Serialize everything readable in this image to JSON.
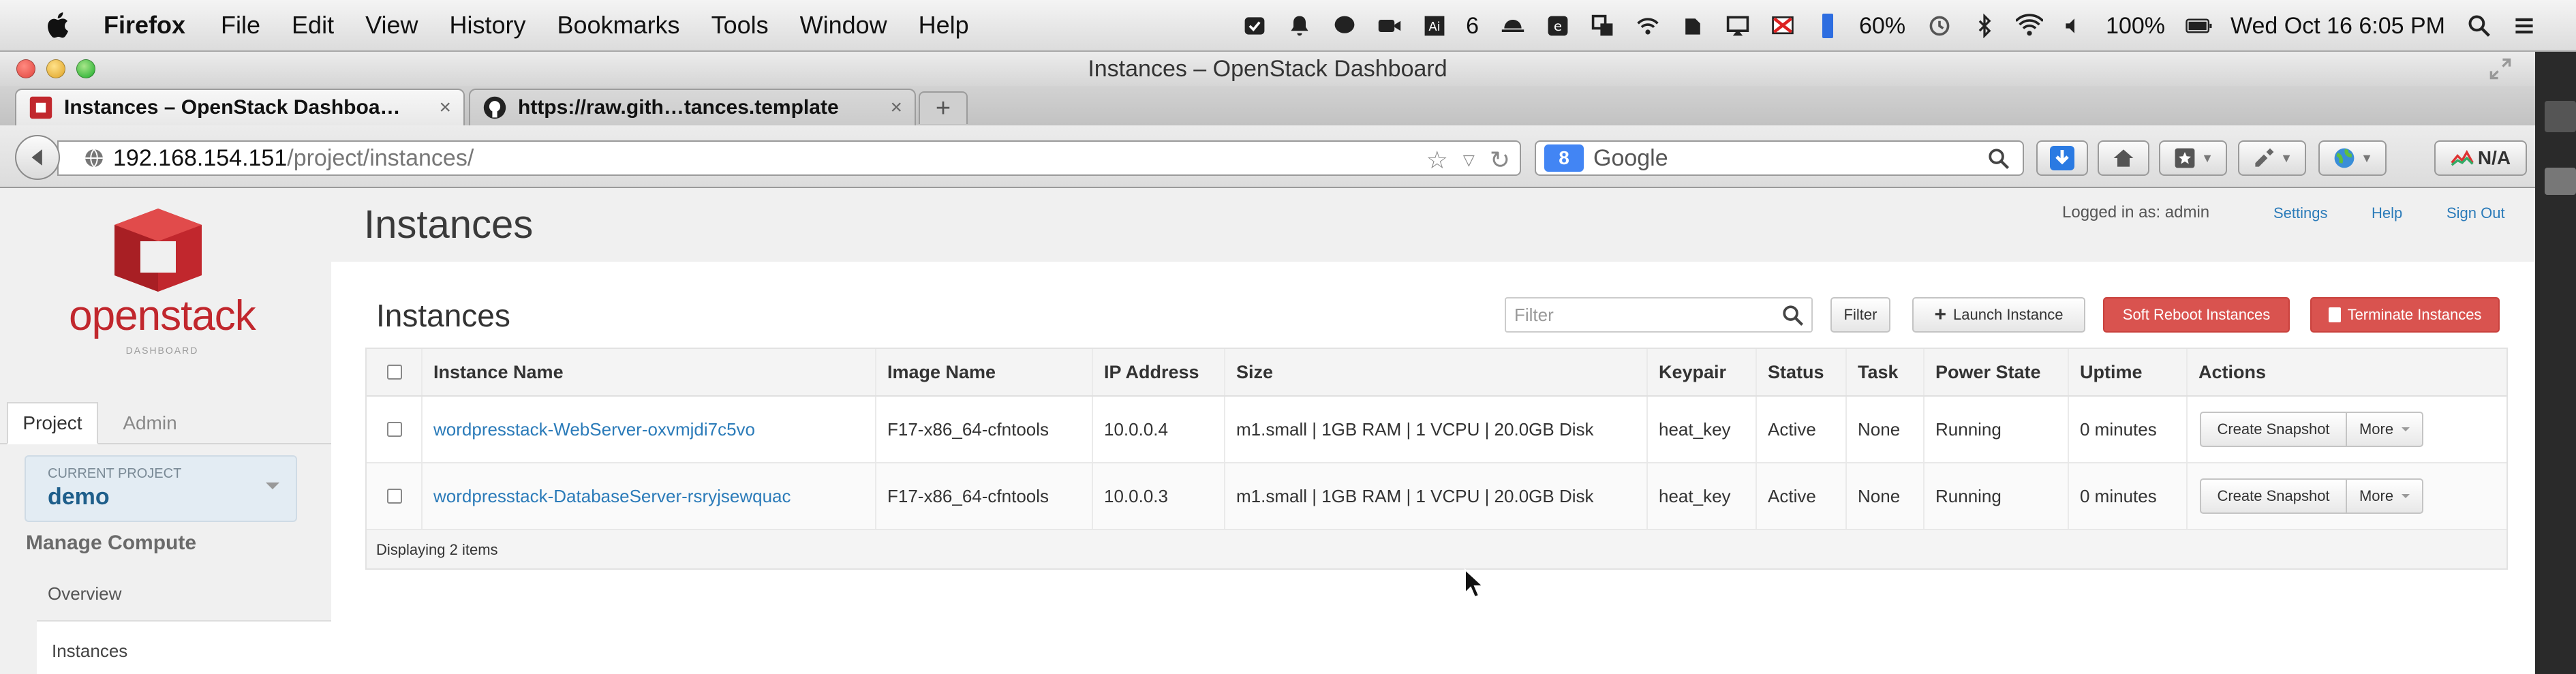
{
  "menubar": {
    "app_name": "Firefox",
    "items": [
      "File",
      "Edit",
      "View",
      "History",
      "Bookmarks",
      "Tools",
      "Window",
      "Help"
    ],
    "status": {
      "badge_count": "6",
      "battery_percent": "60%",
      "volume_percent": "100%",
      "datetime": "Wed Oct 16  6:05 PM"
    }
  },
  "window": {
    "title": "Instances – OpenStack Dashboard"
  },
  "tabs": [
    {
      "label": "Instances – OpenStack Dashboa…",
      "close": "×",
      "icon": "openstack-favicon"
    },
    {
      "label": "https://raw.gith…tances.template",
      "close": "×",
      "icon": "github-favicon"
    }
  ],
  "newtab_label": "+",
  "navbar": {
    "url_host": "192.168.154.151",
    "url_path": "/project/instances/",
    "search_engine_badge": "8",
    "search_placeholder": "Google",
    "na_label": "N/A"
  },
  "sidebar": {
    "logo_text": "openstack",
    "logo_sub": "DASHBOARD",
    "tabs": [
      "Project",
      "Admin"
    ],
    "project_caption": "CURRENT PROJECT",
    "project_name": "demo",
    "section": "Manage Compute",
    "links": [
      "Overview",
      "Instances"
    ]
  },
  "header": {
    "title": "Instances",
    "logged_in": "Logged in as: admin",
    "settings": "Settings",
    "help": "Help",
    "signout": "Sign Out"
  },
  "content": {
    "title": "Instances",
    "filter_placeholder": "Filter",
    "filter_button": "Filter",
    "launch_button": "Launch Instance",
    "soft_reboot_button": "Soft Reboot Instances",
    "terminate_button": "Terminate Instances",
    "columns": [
      "Instance Name",
      "Image Name",
      "IP Address",
      "Size",
      "Keypair",
      "Status",
      "Task",
      "Power State",
      "Uptime",
      "Actions"
    ],
    "rows": [
      {
        "name": "wordpresstack-WebServer-oxvmjdi7c5vo",
        "image": "F17-x86_64-cfntools",
        "ip": "10.0.0.4",
        "size": "m1.small | 1GB RAM | 1 VCPU | 20.0GB Disk",
        "keypair": "heat_key",
        "status": "Active",
        "task": "None",
        "power": "Running",
        "uptime": "0 minutes",
        "action": "Create Snapshot",
        "more": "More"
      },
      {
        "name": "wordpresstack-DatabaseServer-rsryjsewquac",
        "image": "F17-x86_64-cfntools",
        "ip": "10.0.0.3",
        "size": "m1.small | 1GB RAM | 1 VCPU | 20.0GB Disk",
        "keypair": "heat_key",
        "status": "Active",
        "task": "None",
        "power": "Running",
        "uptime": "0 minutes",
        "action": "Create Snapshot",
        "more": "More"
      }
    ],
    "footer": "Displaying 2 items"
  },
  "colors": {
    "openstack_red": "#c1272d",
    "link_blue": "#2b7bb9",
    "danger_red": "#d9534f"
  }
}
